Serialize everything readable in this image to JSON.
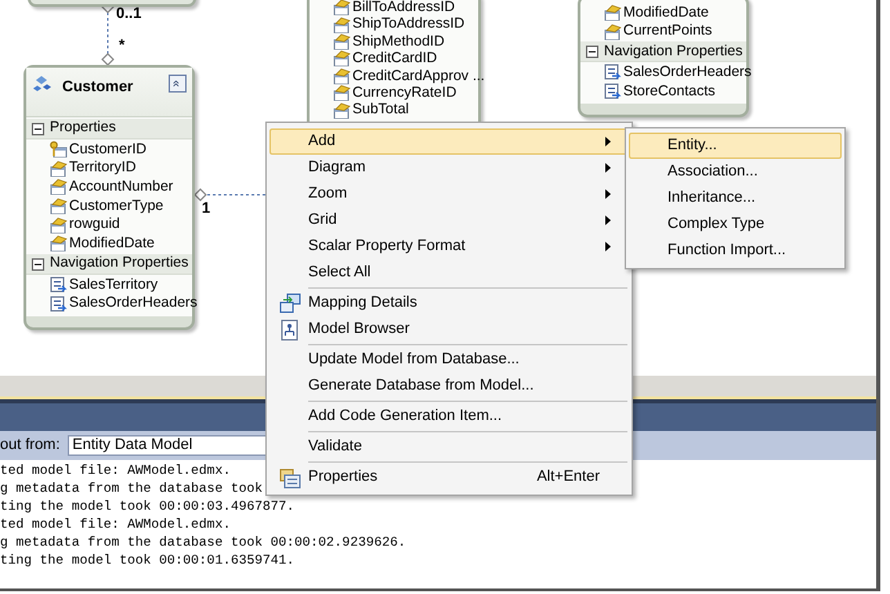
{
  "diagram": {
    "entities": [
      {
        "title": "Customer",
        "collapse_button": "«",
        "sections": [
          {
            "heading": "Properties",
            "expanded": true,
            "items": [
              {
                "label": "CustomerID",
                "kind": "key"
              },
              {
                "label": "TerritoryID",
                "kind": "scalar"
              },
              {
                "label": "AccountNumber",
                "kind": "scalar"
              },
              {
                "label": "CustomerType",
                "kind": "scalar"
              },
              {
                "label": "rowguid",
                "kind": "scalar"
              },
              {
                "label": "ModifiedDate",
                "kind": "scalar"
              }
            ]
          },
          {
            "heading": "Navigation Properties",
            "expanded": true,
            "items": [
              {
                "label": "SalesTerritory",
                "kind": "navigation"
              },
              {
                "label": "SalesOrderHeaders",
                "kind": "navigation"
              }
            ]
          }
        ]
      },
      {
        "sections": [
          {
            "items": [
              {
                "label": "BillToAddressID",
                "kind": "scalar"
              },
              {
                "label": "ShipToAddressID",
                "kind": "scalar"
              },
              {
                "label": "ShipMethodID",
                "kind": "scalar"
              },
              {
                "label": "CreditCardID",
                "kind": "scalar"
              },
              {
                "label": "CreditCardApprov ...",
                "kind": "scalar"
              },
              {
                "label": "CurrencyRateID",
                "kind": "scalar"
              },
              {
                "label": "SubTotal",
                "kind": "scalar"
              }
            ]
          }
        ]
      },
      {
        "sections": [
          {
            "items": [
              {
                "label": "ModifiedDate",
                "kind": "scalar"
              },
              {
                "label": "CurrentPoints",
                "kind": "scalar"
              }
            ]
          },
          {
            "heading": "Navigation Properties",
            "expanded": true,
            "items": [
              {
                "label": "SalesOrderHeaders",
                "kind": "navigation"
              },
              {
                "label": "StoreContacts",
                "kind": "navigation"
              }
            ]
          }
        ]
      }
    ],
    "multiplicities": [
      "0..1",
      "*",
      "1"
    ]
  },
  "context_menu": {
    "items": [
      {
        "label": "Add",
        "selected": true,
        "submenu": true
      },
      {
        "label": "Diagram",
        "selected": false,
        "submenu": true
      },
      {
        "label": "Zoom",
        "selected": false,
        "submenu": true
      },
      {
        "label": "Grid",
        "selected": false,
        "submenu": true
      },
      {
        "label": "Scalar Property Format",
        "selected": false,
        "submenu": true
      },
      {
        "label": "Select All",
        "selected": false,
        "submenu": false
      },
      {
        "label": "Mapping Details",
        "selected": false,
        "submenu": false,
        "separator_before": true
      },
      {
        "label": "Model Browser",
        "selected": false,
        "submenu": false
      },
      {
        "label": "Update Model from Database...",
        "selected": false,
        "submenu": false,
        "separator_before": true
      },
      {
        "label": "Generate Database from Model...",
        "selected": false,
        "submenu": false
      },
      {
        "label": "Add Code Generation Item...",
        "selected": false,
        "submenu": false,
        "separator_before": true
      },
      {
        "label": "Validate",
        "selected": false,
        "submenu": false,
        "separator_before": true
      },
      {
        "label": "Properties",
        "selected": false,
        "submenu": false,
        "separator_before": true,
        "shortcut": "Alt+Enter"
      }
    ]
  },
  "submenu": {
    "items": [
      {
        "label": "Entity...",
        "selected": true
      },
      {
        "label": "Association...",
        "selected": false
      },
      {
        "label": "Inheritance...",
        "selected": false
      },
      {
        "label": "Complex Type",
        "selected": false
      },
      {
        "label": "Function Import...",
        "selected": false
      }
    ]
  },
  "output_panel": {
    "show_output_from_label": "out from:",
    "source": "Entity Data Model",
    "lines": [
      "ted model file: AWModel.edmx.",
      "g metadata from the database took",
      "ting the model took 00:00:03.4967877.",
      "ted model file: AWModel.edmx.",
      "g metadata from the database took 00:00:02.9239626.",
      "ting the model took 00:00:01.6359741."
    ]
  }
}
